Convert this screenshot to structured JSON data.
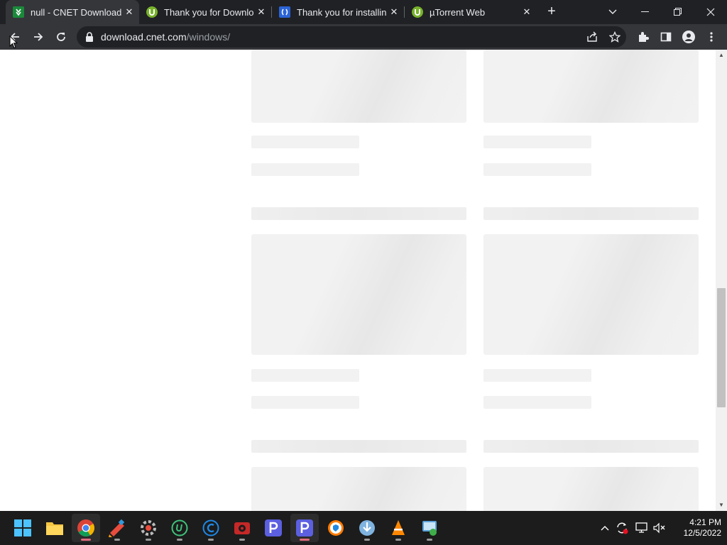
{
  "browser": {
    "tabs": [
      {
        "title": "null - CNET Download",
        "favicon": "cnet-icon",
        "active": true
      },
      {
        "title": "Thank you for Downloa",
        "favicon": "utorrent-icon",
        "active": false
      },
      {
        "title": "Thank you for installing",
        "favicon": "install-icon",
        "active": false
      },
      {
        "title": "µTorrent Web",
        "favicon": "utorrent-icon",
        "active": false
      }
    ],
    "url_host": "download.cnet.com",
    "url_path": "/windows/",
    "colors": {
      "frame": "#202124",
      "toolbar": "#35363a",
      "text": "#e8eaed",
      "skeleton": "#f2f2f2"
    }
  },
  "taskbar": {
    "apps": [
      "start-icon",
      "file-explorer-icon",
      "chrome-icon",
      "ccleaner-icon",
      "speccy-icon",
      "utorrent-web-icon",
      "ccleaner-browser-icon",
      "media-app-icon",
      "pdf-app-icon",
      "pdf-app-active-icon",
      "avast-browser-icon",
      "installer-icon",
      "vlc-icon",
      "network-tool-icon"
    ],
    "time": "4:21 PM",
    "date": "12/5/2022"
  }
}
